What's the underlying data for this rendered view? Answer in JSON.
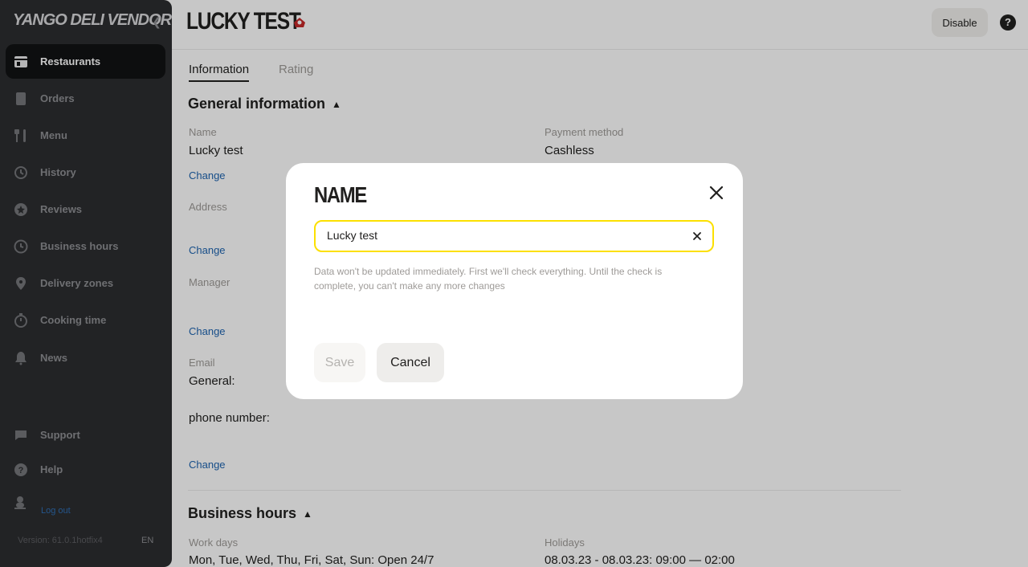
{
  "sidebar": {
    "logo": "YANGO DELI VENDOR",
    "items": [
      {
        "label": "Restaurants",
        "icon": "storefront-icon",
        "active": true
      },
      {
        "label": "Orders",
        "icon": "orders-icon"
      },
      {
        "label": "Menu",
        "icon": "fork-knife-icon"
      },
      {
        "label": "History",
        "icon": "history-icon"
      },
      {
        "label": "Reviews",
        "icon": "reviews-star-icon"
      },
      {
        "label": "Business hours",
        "icon": "clock-icon"
      },
      {
        "label": "Delivery zones",
        "icon": "map-pin-icon"
      },
      {
        "label": "Cooking time",
        "icon": "stopwatch-icon"
      },
      {
        "label": "News",
        "icon": "bell-icon"
      },
      {
        "label": "Support",
        "icon": "chat-icon"
      },
      {
        "label": "Help",
        "icon": "help-icon"
      }
    ],
    "logout": "Log out",
    "version": "Version: 61.0.1hotfix4",
    "language": "EN"
  },
  "header": {
    "title": "LUCKY TEST",
    "disable_label": "Disable",
    "help_glyph": "?"
  },
  "tabs": [
    {
      "label": "Information",
      "active": true
    },
    {
      "label": "Rating",
      "active": false
    }
  ],
  "general": {
    "title": "General information",
    "name_label": "Name",
    "name_value": "Lucky test",
    "payment_label": "Payment method",
    "payment_value": "Cashless",
    "change": "Change",
    "address_label": "Address",
    "manager_label": "Manager",
    "email_label": "Email",
    "general_label": "General:",
    "phone_label": "phone number:"
  },
  "business_hours": {
    "title": "Business hours",
    "workdays_label": "Work days",
    "workdays_value": "Mon, Tue, Wed, Thu, Fri, Sat, Sun: Open 24/7",
    "holidays_label": "Holidays",
    "holidays_value": "08.03.23 - 08.03.23: 09:00 — 02:00"
  },
  "modal": {
    "title": "NAME",
    "input_value": "Lucky test",
    "hint": "Data won't be updated immediately. First we'll check everything. Until the check is complete, you can't make any more changes",
    "save_label": "Save",
    "cancel_label": "Cancel"
  },
  "colors": {
    "sidebar_bg": "#2c2d30",
    "active_item_bg": "#111214",
    "accent_yellow": "#fce000",
    "link_blue": "#1e64b0"
  }
}
